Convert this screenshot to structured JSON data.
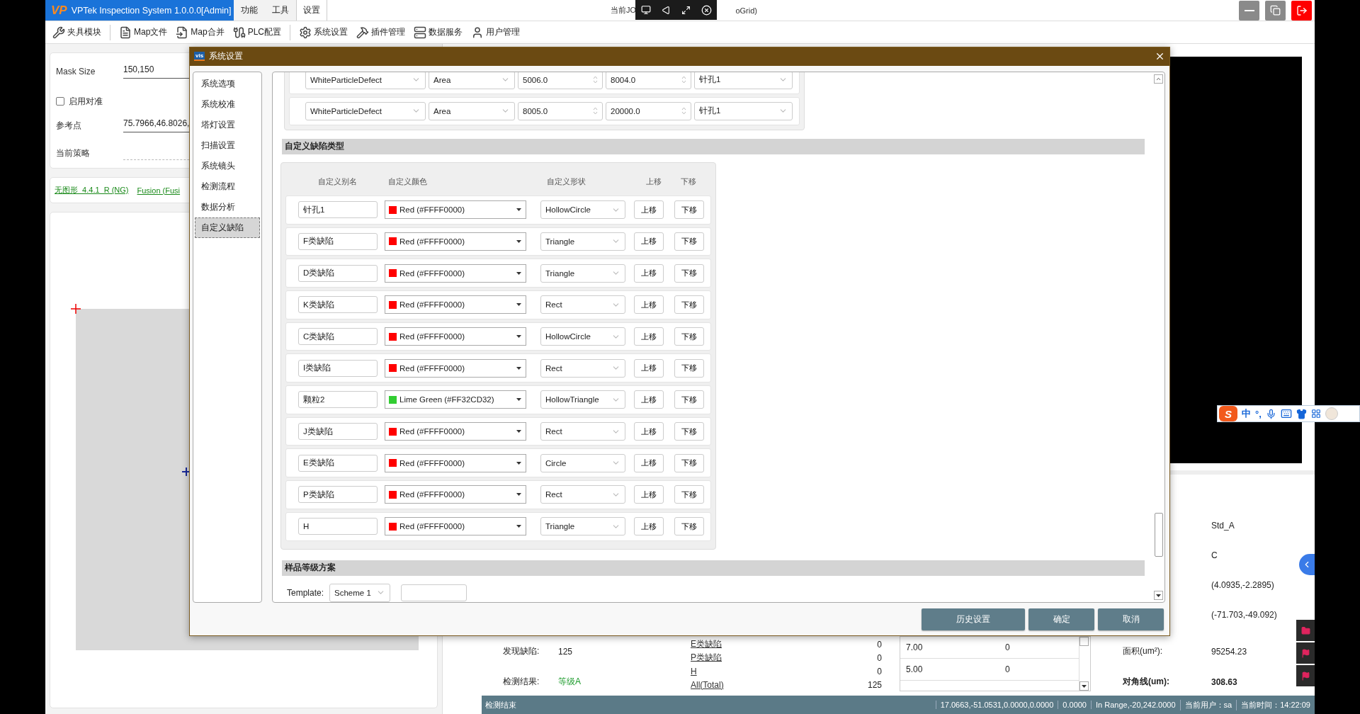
{
  "title_bar": {
    "logo": "VP",
    "title": "VPTek Inspection System 1.0.0.0[Admin]",
    "menus": [
      {
        "label": "功能",
        "selected": false
      },
      {
        "label": "工具",
        "selected": false
      },
      {
        "label": "设置",
        "selected": true
      }
    ],
    "job_left": "当前JO",
    "job_right": "oGrid)"
  },
  "toolbar": [
    "夹具模块",
    "Map文件",
    "Map合并",
    "PLC配置",
    "系统设置",
    "插件管理",
    "数据服务",
    "用户管理"
  ],
  "left_panel": {
    "mask_size_label": "Mask Size",
    "mask_size_value": "150,150",
    "align_checkbox": {
      "label": "启用对准",
      "checked": false
    },
    "ref_label": "参考点",
    "ref_value": "75.7966,46.8026,",
    "strategy_label": "当前策略",
    "links": [
      "无图形_4.4.1_R (NG)",
      "Fusion (Fusi"
    ]
  },
  "info_values": [
    "Std_A",
    "C",
    "(4.0935,-2.2895)",
    "(-71.703,-49.092)"
  ],
  "stats": {
    "found_label": "发现缺陷:",
    "found_value": "125",
    "result_label": "检测结果:",
    "result_value": "等级A",
    "defect_counts": [
      {
        "name": "E类缺陷",
        "count": "0"
      },
      {
        "name": "P类缺陷",
        "count": "0"
      },
      {
        "name": "H",
        "count": "0"
      },
      {
        "name": "All(Total)",
        "count": "125"
      }
    ],
    "table_rows": [
      [
        "7.00",
        "0"
      ],
      [
        "5.00",
        "0"
      ]
    ],
    "area_label": "面积(um²):",
    "area_value": "95254.23",
    "diag_label": "对角线(um):",
    "diag_value": "308.63"
  },
  "status_bar": {
    "message": "检测结束",
    "segments": [
      "17.0663,-51.0531,0.0000,0.0000",
      "0.0000",
      "In Range,-20,242.0000",
      "当前用户：sa",
      "当前时间：14:22:09"
    ]
  },
  "ime_bar": {
    "logo": "S",
    "mode": "中",
    "punct": "°,"
  },
  "dialog": {
    "icon_text": "vis",
    "title": "系统设置",
    "nav": [
      {
        "label": "系统选项",
        "selected": false
      },
      {
        "label": "系统校准",
        "selected": false
      },
      {
        "label": "塔灯设置",
        "selected": false
      },
      {
        "label": "扫描设置",
        "selected": false
      },
      {
        "label": "系统镜头",
        "selected": false
      },
      {
        "label": "检测流程",
        "selected": false
      },
      {
        "label": "数据分析",
        "selected": false
      },
      {
        "label": "自定义缺陷",
        "selected": true
      }
    ],
    "filter_rows": [
      {
        "defect": "WhiteParticleDefect",
        "metric": "Area",
        "min": "5006.0",
        "max": "8004.0",
        "alias": "针孔1"
      },
      {
        "defect": "WhiteParticleDefect",
        "metric": "Area",
        "min": "8005.0",
        "max": "20000.0",
        "alias": "针孔1"
      }
    ],
    "custom_section": "自定义缺陷类型",
    "columns": [
      "自定义别名",
      "自定义颜色",
      "自定义形状",
      "上移",
      "下移"
    ],
    "defects": [
      {
        "alias": "针孔1",
        "color": "#ff0000",
        "color_name": "Red (#FFFF0000)",
        "shape": "HollowCircle",
        "up": "上移",
        "down": "下移"
      },
      {
        "alias": "F类缺陷",
        "color": "#ff0000",
        "color_name": "Red (#FFFF0000)",
        "shape": "Triangle",
        "up": "上移",
        "down": "下移"
      },
      {
        "alias": "D类缺陷",
        "color": "#ff0000",
        "color_name": "Red (#FFFF0000)",
        "shape": "Triangle",
        "up": "上移",
        "down": "下移"
      },
      {
        "alias": "K类缺陷",
        "color": "#ff0000",
        "color_name": "Red (#FFFF0000)",
        "shape": "Rect",
        "up": "上移",
        "down": "下移"
      },
      {
        "alias": "C类缺陷",
        "color": "#ff0000",
        "color_name": "Red (#FFFF0000)",
        "shape": "HollowCircle",
        "up": "上移",
        "down": "下移"
      },
      {
        "alias": "I类缺陷",
        "color": "#ff0000",
        "color_name": "Red (#FFFF0000)",
        "shape": "Rect",
        "up": "上移",
        "down": "下移"
      },
      {
        "alias": "颗粒2",
        "color": "#32cd32",
        "color_name": "Lime Green (#FF32CD32)",
        "shape": "HollowTriangle",
        "up": "上移",
        "down": "下移"
      },
      {
        "alias": "J类缺陷",
        "color": "#ff0000",
        "color_name": "Red (#FFFF0000)",
        "shape": "Rect",
        "up": "上移",
        "down": "下移"
      },
      {
        "alias": "E类缺陷",
        "color": "#ff0000",
        "color_name": "Red (#FFFF0000)",
        "shape": "Circle",
        "up": "上移",
        "down": "下移"
      },
      {
        "alias": "P类缺陷",
        "color": "#ff0000",
        "color_name": "Red (#FFFF0000)",
        "shape": "Rect",
        "up": "上移",
        "down": "下移"
      },
      {
        "alias": "H",
        "color": "#ff0000",
        "color_name": "Red (#FFFF0000)",
        "shape": "Triangle",
        "up": "上移",
        "down": "下移"
      }
    ],
    "grade_section": "样品等级方案",
    "template_label": "Template:",
    "template_value": "Scheme 1",
    "buttons": [
      "历史设置",
      "确定",
      "取消"
    ]
  }
}
